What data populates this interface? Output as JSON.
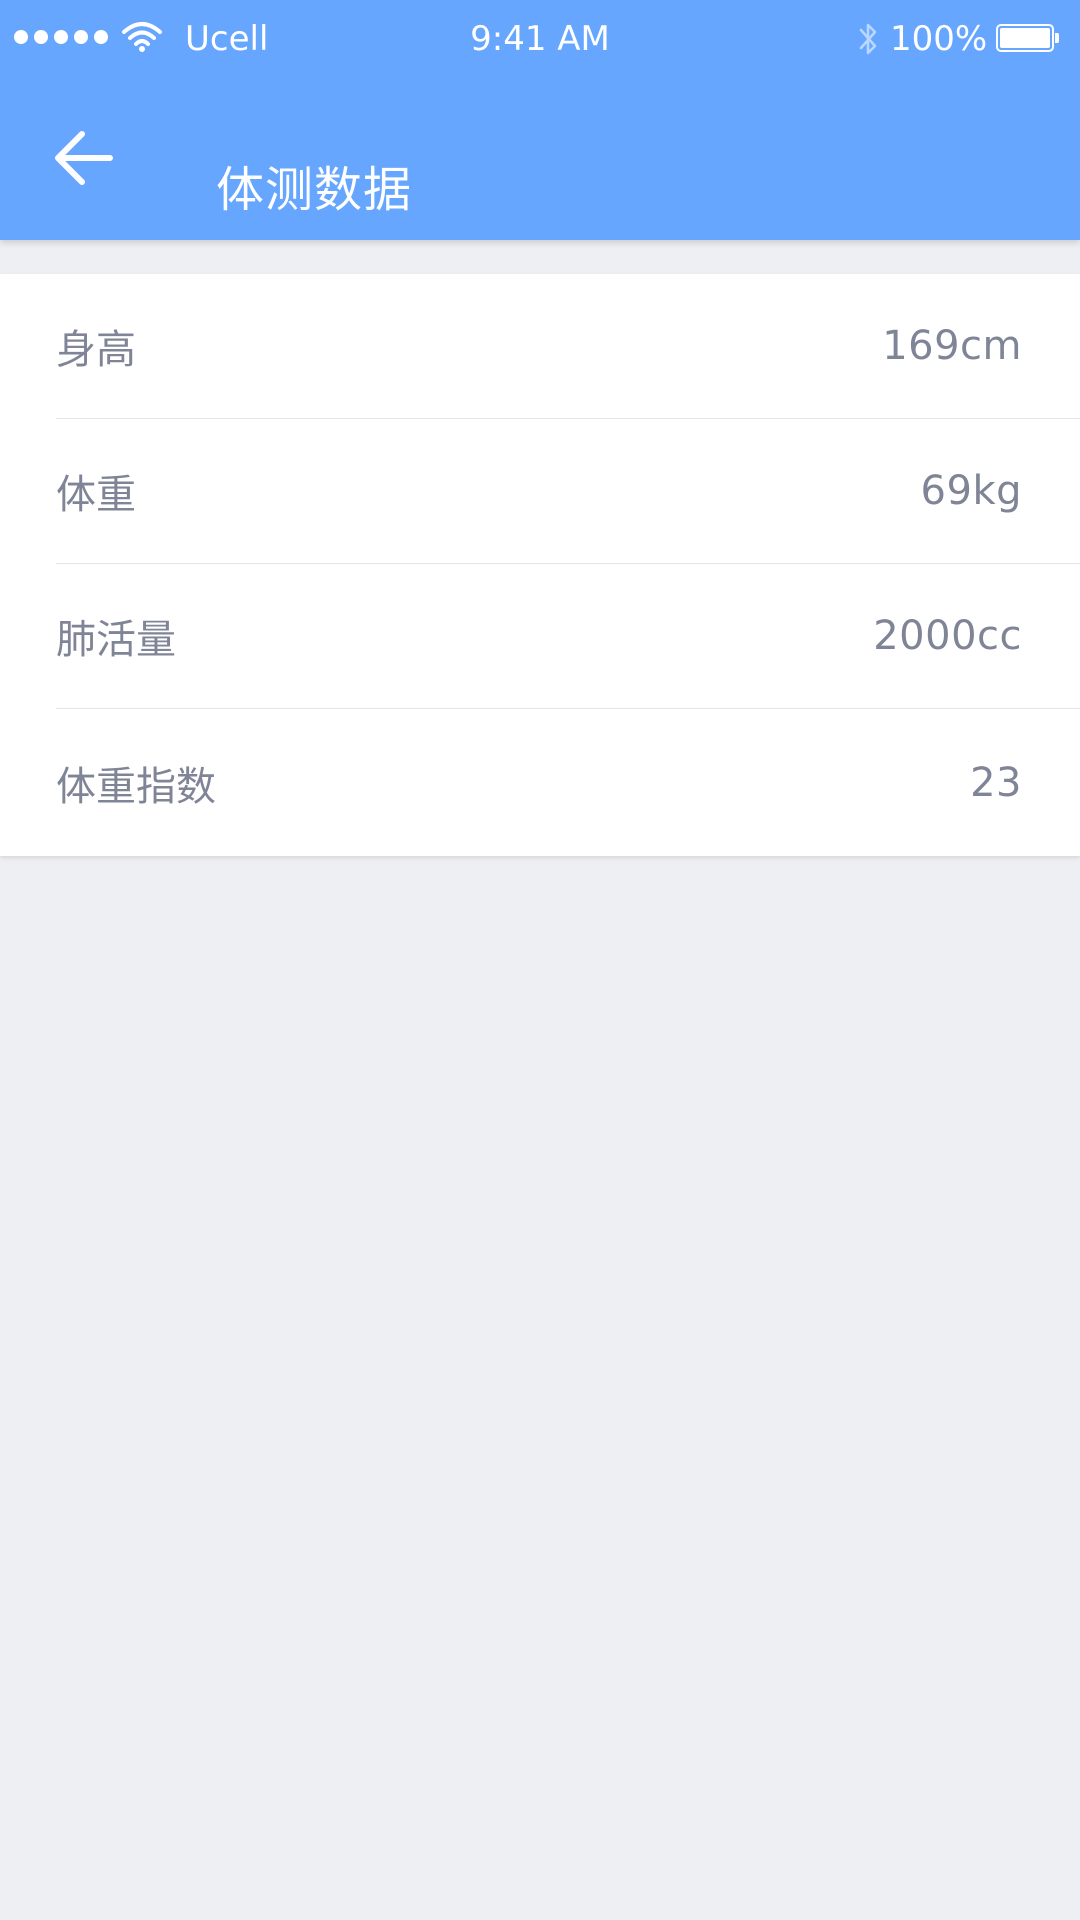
{
  "status_bar": {
    "carrier": "Ucell",
    "time": "9:41 AM",
    "battery_percent": "100%"
  },
  "app_bar": {
    "title": "体测数据"
  },
  "metrics": [
    {
      "label": "身高",
      "value": "169cm"
    },
    {
      "label": "体重",
      "value": "69kg"
    },
    {
      "label": "肺活量",
      "value": "2000cc"
    },
    {
      "label": "体重指数",
      "value": "23"
    }
  ],
  "colors": {
    "header": "#66A6FF",
    "background": "#EEEFF3",
    "card": "#FFFFFF",
    "text": "#7F8596",
    "divider": "#E3E5EA"
  },
  "icons": {
    "signal": "signal-dots-icon",
    "wifi": "wifi-icon",
    "bluetooth": "bluetooth-icon",
    "battery": "battery-icon",
    "back": "arrow-left-icon"
  }
}
